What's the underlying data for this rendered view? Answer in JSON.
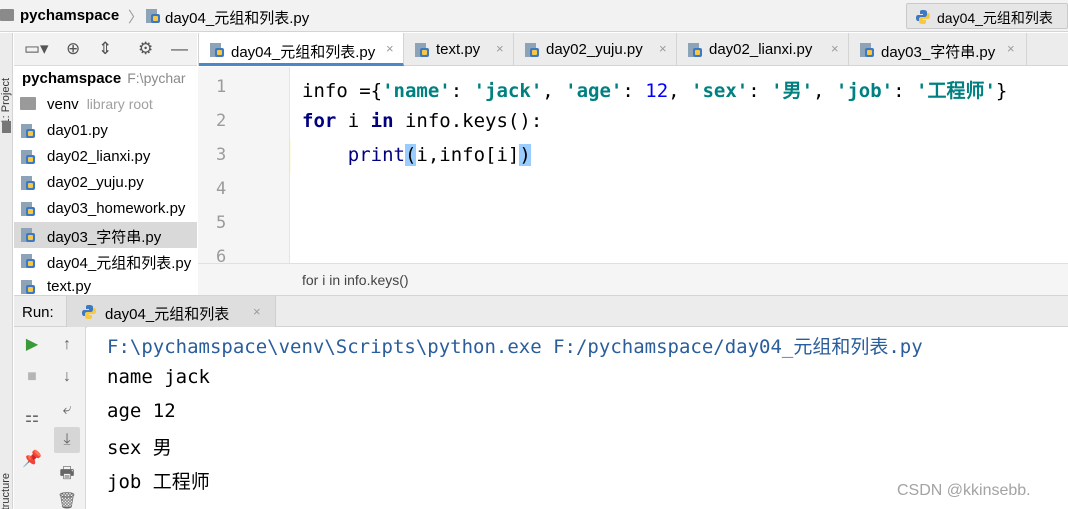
{
  "colors": {
    "keyword": "#000080",
    "string": "#008080",
    "number": "#0000ff",
    "caret_line": "#fffae3",
    "bracket_highlight": "#99ccff",
    "console_command": "#2a5d9b",
    "selected_row": "#d9d9d9"
  },
  "icons": {
    "nav_folder": "folder-icon",
    "python_file": "python-file-icon",
    "run": "play-icon",
    "stop": "stop-icon"
  },
  "navbar": {
    "project_name": "pychamspace",
    "separator": "〉",
    "file_name": "day04_元组和列表.py",
    "run_config": "day04_元组和列表"
  },
  "left_stripe": {
    "project_label": "1: Project",
    "structure_label": "Structure"
  },
  "project_toolbar": {
    "buttons": [
      "▭▾",
      "⊕",
      "⇕",
      "⚙",
      "—"
    ]
  },
  "project_tree": {
    "root": {
      "name": "pychamspace",
      "path": "F:\\pychar"
    },
    "venv": {
      "name": "venv",
      "note": "library root"
    },
    "files": [
      "day01.py",
      "day02_lianxi.py",
      "day02_yuju.py",
      "day03_homework.py",
      "day03_字符串.py",
      "day04_元组和列表.py",
      "text.py"
    ],
    "selected_file": "day03_字符串.py"
  },
  "editor_tabs": [
    {
      "label": "day04_元组和列表.py",
      "close": "×",
      "active": true
    },
    {
      "label": "text.py",
      "close": "×",
      "active": false
    },
    {
      "label": "day02_yuju.py",
      "close": "×",
      "active": false
    },
    {
      "label": "day02_lianxi.py",
      "close": "×",
      "active": false
    },
    {
      "label": "day03_字符串.py",
      "close": "×",
      "active": false
    }
  ],
  "editor": {
    "line_numbers": [
      "1",
      "2",
      "3",
      "4",
      "5",
      "6"
    ],
    "line1": {
      "ident": "info",
      "assign": " ={",
      "k_name": "'name'",
      "colon1": ": ",
      "v_name": "'jack'",
      "comma1": ", ",
      "k_age": "'age'",
      "colon2": ": ",
      "v_age": "12",
      "comma2": ", ",
      "k_sex": "'sex'",
      "colon3": ": ",
      "v_sex": "'男'",
      "comma3": ", ",
      "k_job": "'job'",
      "colon4": ": ",
      "v_job": "'工程师'",
      "close": "}"
    },
    "line2": {
      "kw_for": "for",
      "var": " i ",
      "kw_in": "in",
      "rest": " info.keys():"
    },
    "line3": {
      "indent": "    ",
      "builtin": "print",
      "open": "(",
      "args": "i,info[i]",
      "close": ")"
    },
    "breadcrumb": "for i in info.keys()"
  },
  "run_panel": {
    "title": "Run:",
    "tab_label": "day04_元组和列表",
    "tab_close": "×",
    "side_buttons": [
      "▶",
      "↑",
      "■",
      "↓",
      "⚏",
      "⤶",
      "📌",
      "⤓",
      "🖶",
      "🗑"
    ],
    "console": {
      "command": "F:\\pychamspace\\venv\\Scripts\\python.exe F:/pychamspace/day04_元组和列表.py",
      "output": [
        "name jack",
        "age 12",
        "sex 男",
        "job 工程师"
      ]
    }
  },
  "watermark": "CSDN @kkinsebb."
}
